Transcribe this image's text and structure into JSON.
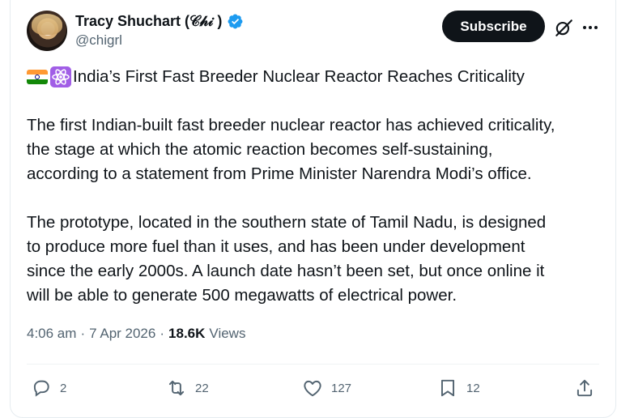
{
  "author": {
    "display_name": "Tracy Shuchart (𝒞𝒽𝒾 )",
    "handle": "@chigrl",
    "verified": true
  },
  "header": {
    "subscribe_label": "Subscribe",
    "grok_icon": "grok-icon",
    "more_icon": "more-icon"
  },
  "tweet": {
    "title": "India’s First Fast Breeder Nuclear Reactor Reaches Criticality",
    "title_emojis": [
      "india-flag-icon",
      "atom-symbol-icon"
    ],
    "paragraph1_lines": [
      "The first Indian-built fast breeder nuclear reactor has achieved criticality,",
      "the stage at which the atomic reaction becomes self-sustaining,",
      "according to a statement from Prime Minister Narendra Modi’s office."
    ],
    "paragraph2_lines": [
      "The prototype, located in the southern state of Tamil Nadu, is designed",
      "to produce more fuel than it uses, and has been under development",
      "since the early 2000s. A launch date hasn’t been set, but once online it",
      "will be able to generate 500 megawatts of electrical power."
    ]
  },
  "meta": {
    "time": "4:06 am",
    "separator": "·",
    "date": "7 Apr 2026",
    "views_count": "18.6K",
    "views_label": "Views"
  },
  "actions": {
    "replies": "2",
    "reposts": "22",
    "likes": "127",
    "bookmarks": "12"
  },
  "colors": {
    "text": "#0f1419",
    "secondary": "#536471",
    "verified_blue": "#1d9bf0",
    "button_bg": "#0f1419"
  }
}
